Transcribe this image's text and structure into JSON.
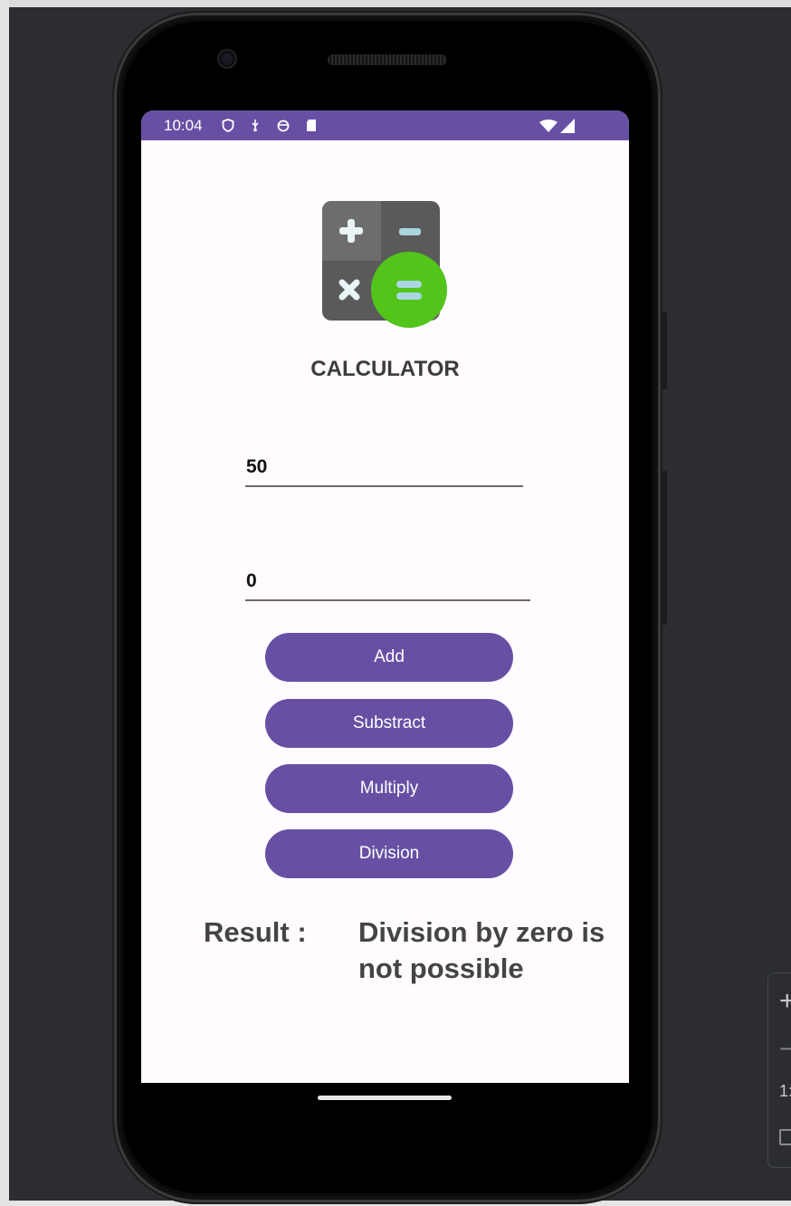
{
  "status_bar": {
    "time": "10:04",
    "icons": [
      "shield-icon",
      "usb-icon",
      "circle-icon",
      "sd-card-icon"
    ],
    "right_icons": [
      "wifi-icon",
      "cell-signal-icon"
    ],
    "color": "#6750a4"
  },
  "app": {
    "logo_icon": "calculator-logo-icon",
    "title": "CALCULATOR"
  },
  "inputs": {
    "first_value": "50",
    "second_value": "0"
  },
  "buttons": {
    "add": "Add",
    "subtract": "Substract",
    "multiply": "Multiply",
    "division": "Division",
    "color": "#6750a4"
  },
  "result": {
    "label": "Result :",
    "value": "Division by zero is not possible"
  },
  "toolbar": {
    "plus": "+",
    "minus": "−",
    "ratio": "1:"
  }
}
